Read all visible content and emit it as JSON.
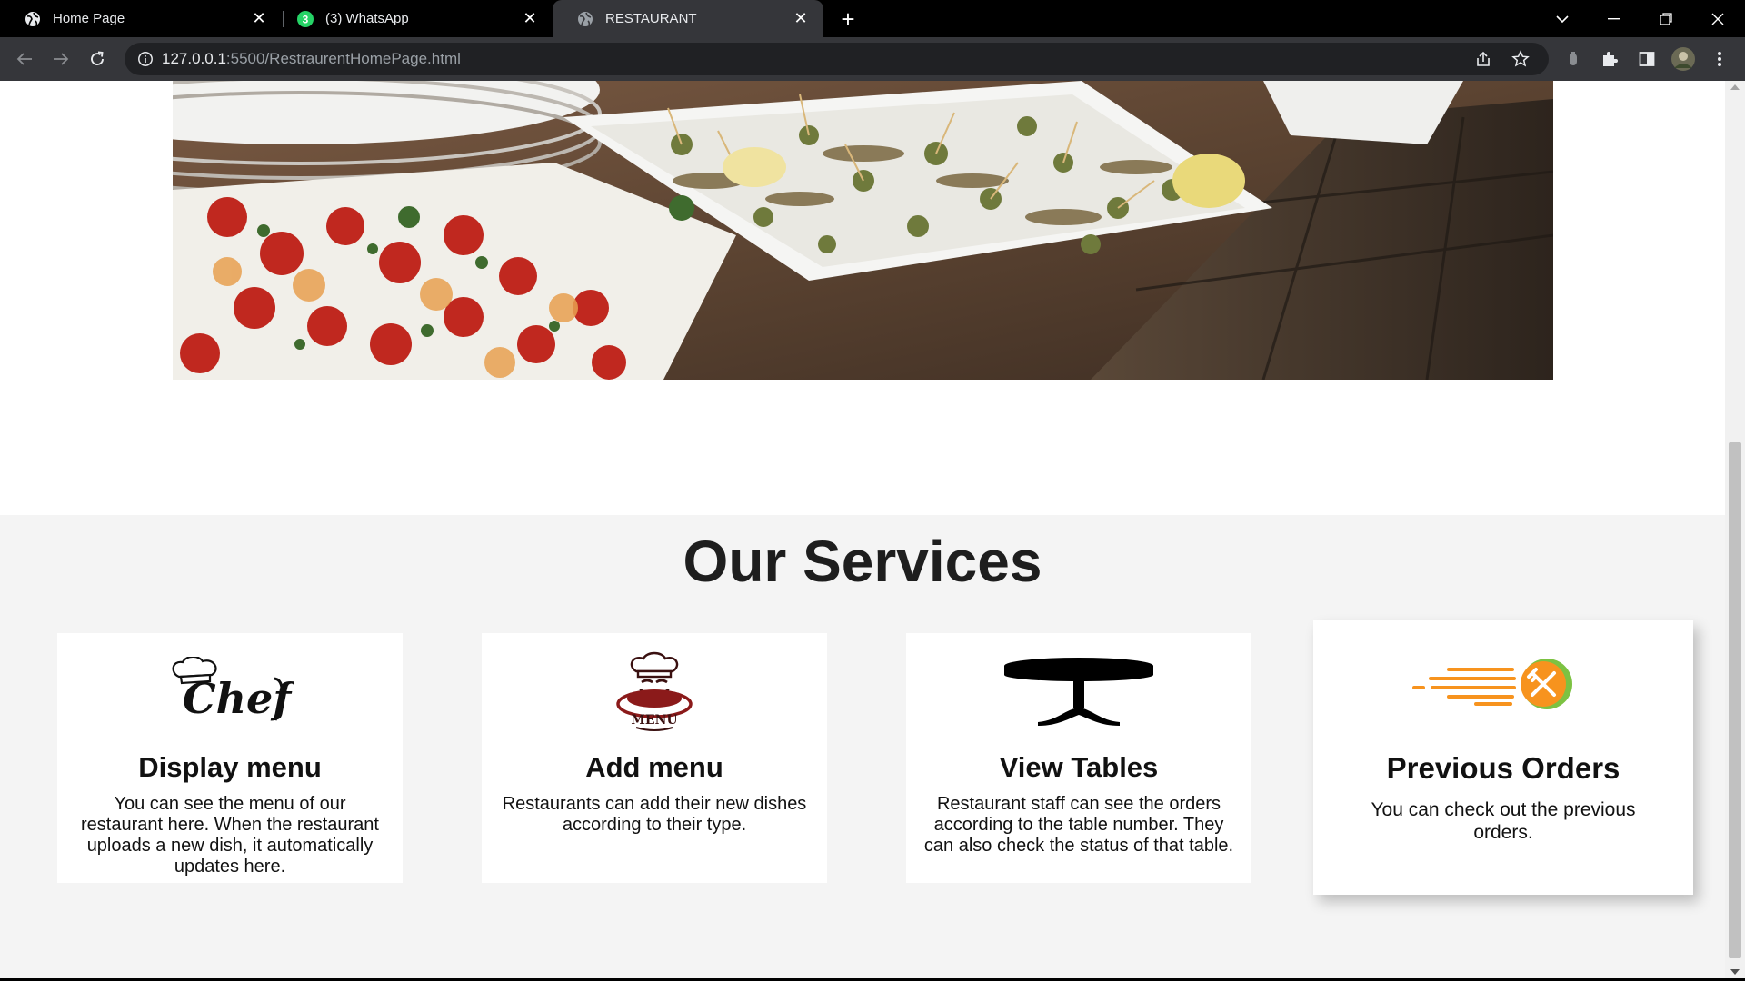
{
  "browser": {
    "tabs": [
      {
        "title": "Home Page",
        "icon": "globe-icon",
        "active": false
      },
      {
        "title": "(3) WhatsApp",
        "icon": "whatsapp-icon",
        "badge": "3",
        "active": false
      },
      {
        "title": "RESTAURANT",
        "icon": "globe-icon",
        "active": true
      }
    ],
    "url_host": "127.0.0.1",
    "url_rest": ":5500/RestraurentHomePage.html"
  },
  "hero": {
    "image": "restaurant-food-platters-photo"
  },
  "services": {
    "title": "Our Services",
    "cards": [
      {
        "icon": "chef-logo-icon",
        "logo_text": "Chef",
        "heading": "Display menu",
        "description": "You can see the menu of our restaurant here. When the restaurant uploads a new dish, it automatically updates here."
      },
      {
        "icon": "chef-menu-logo-icon",
        "logo_text": "MENU",
        "heading": "Add menu",
        "description": "Restaurants can add their new dishes according to their type."
      },
      {
        "icon": "table-icon",
        "heading": "View Tables",
        "description": "Restaurant staff can see the orders according to the table number. They can also check the status of that table."
      },
      {
        "icon": "fast-delivery-icon",
        "heading": "Previous Orders",
        "description": "You can check out the previous orders."
      }
    ]
  },
  "colors": {
    "tabstrip": "#000000",
    "toolbar": "#35363a",
    "services_bg": "#f4f4f4",
    "delivery_orange": "#f7931e",
    "delivery_green": "#7cc242",
    "menu_red": "#8b1a1a"
  }
}
